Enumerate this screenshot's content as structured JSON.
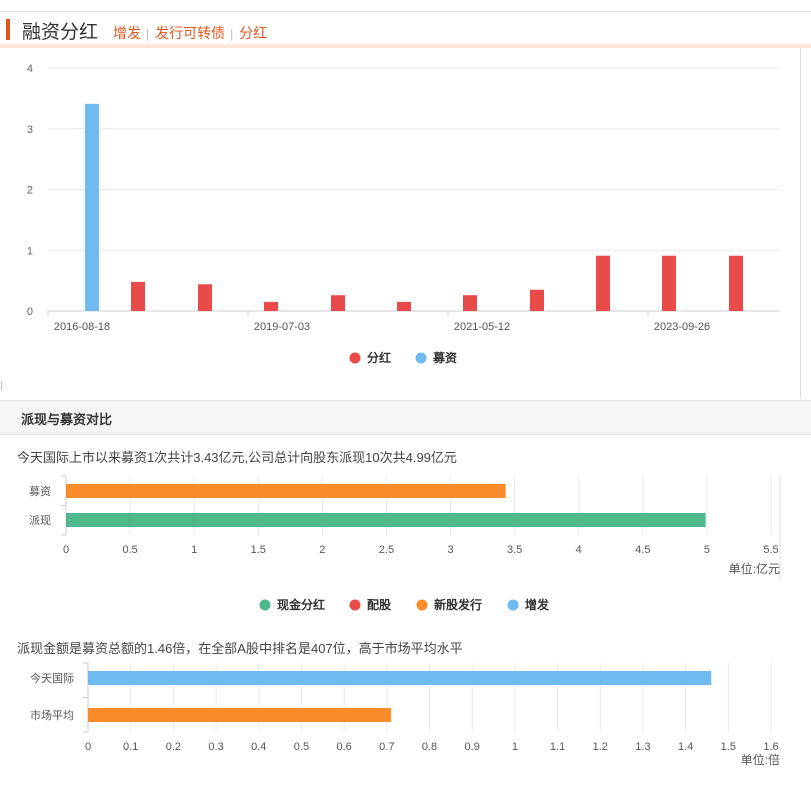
{
  "header": {
    "title": "融资分红",
    "links": [
      "增发",
      "发行可转债",
      "分红"
    ]
  },
  "colors": {
    "accent": "#e2561a",
    "dividend": "#e94a4a",
    "fundraise": "#6fbaf0",
    "cash_dividend": "#4cb88b",
    "new_issue": "#fb8c2b"
  },
  "section": {
    "title": "派现与募资对比"
  },
  "summary1": "今天国际上市以来募资1次共计3.43亿元,公司总计向股东派现10次共4.99亿元",
  "summary2": "派现金额是募资总额的1.46倍，在全部A股中排名是407位，高于市场平均水平",
  "chart_data": [
    {
      "type": "bar",
      "x_tick_labels": [
        "2016-08-18",
        "2019-07-03",
        "2021-05-12",
        "2023-09-26"
      ],
      "ylim": [
        0,
        4
      ],
      "yticks": [
        0,
        1,
        2,
        3,
        4
      ],
      "grid": true,
      "legend_position": "bottom",
      "series": [
        {
          "name": "分红",
          "color": "#e94a4a",
          "values": [
            0.48,
            0.44,
            0.15,
            0.26,
            0.15,
            0.26,
            0.35,
            0.91,
            0.91,
            0.91
          ]
        },
        {
          "name": "募资",
          "color": "#6fbaf0",
          "values": [
            3.41
          ]
        }
      ]
    },
    {
      "type": "bar",
      "orientation": "horizontal",
      "categories": [
        "募资",
        "派现"
      ],
      "values": [
        3.43,
        4.99
      ],
      "bar_colors": [
        "#fb8c2b",
        "#4cb88b"
      ],
      "xlim": [
        0,
        5.5
      ],
      "xticks": [
        "0",
        "0.5",
        "1",
        "1.5",
        "2",
        "2.5",
        "3",
        "3.5",
        "4",
        "4.5",
        "5",
        "5.5"
      ],
      "unit_label": "单位:亿元",
      "grid": true,
      "legend_position": "bottom",
      "legend": [
        {
          "name": "现金分红",
          "color": "#4cb88b"
        },
        {
          "name": "配股",
          "color": "#e94a4a"
        },
        {
          "name": "新股发行",
          "color": "#fb8c2b"
        },
        {
          "name": "增发",
          "color": "#6fbaf0"
        }
      ]
    },
    {
      "type": "bar",
      "orientation": "horizontal",
      "categories": [
        "今天国际",
        "市场平均"
      ],
      "values": [
        1.46,
        0.71
      ],
      "bar_colors": [
        "#6fbaf0",
        "#fb8c2b"
      ],
      "xlim": [
        0,
        1.6
      ],
      "xticks": [
        "0",
        "0.1",
        "0.2",
        "0.3",
        "0.4",
        "0.5",
        "0.6",
        "0.7",
        "0.8",
        "0.9",
        "1",
        "1.1",
        "1.2",
        "1.3",
        "1.4",
        "1.5",
        "1.6"
      ],
      "unit_label": "单位:倍",
      "grid": true
    }
  ]
}
